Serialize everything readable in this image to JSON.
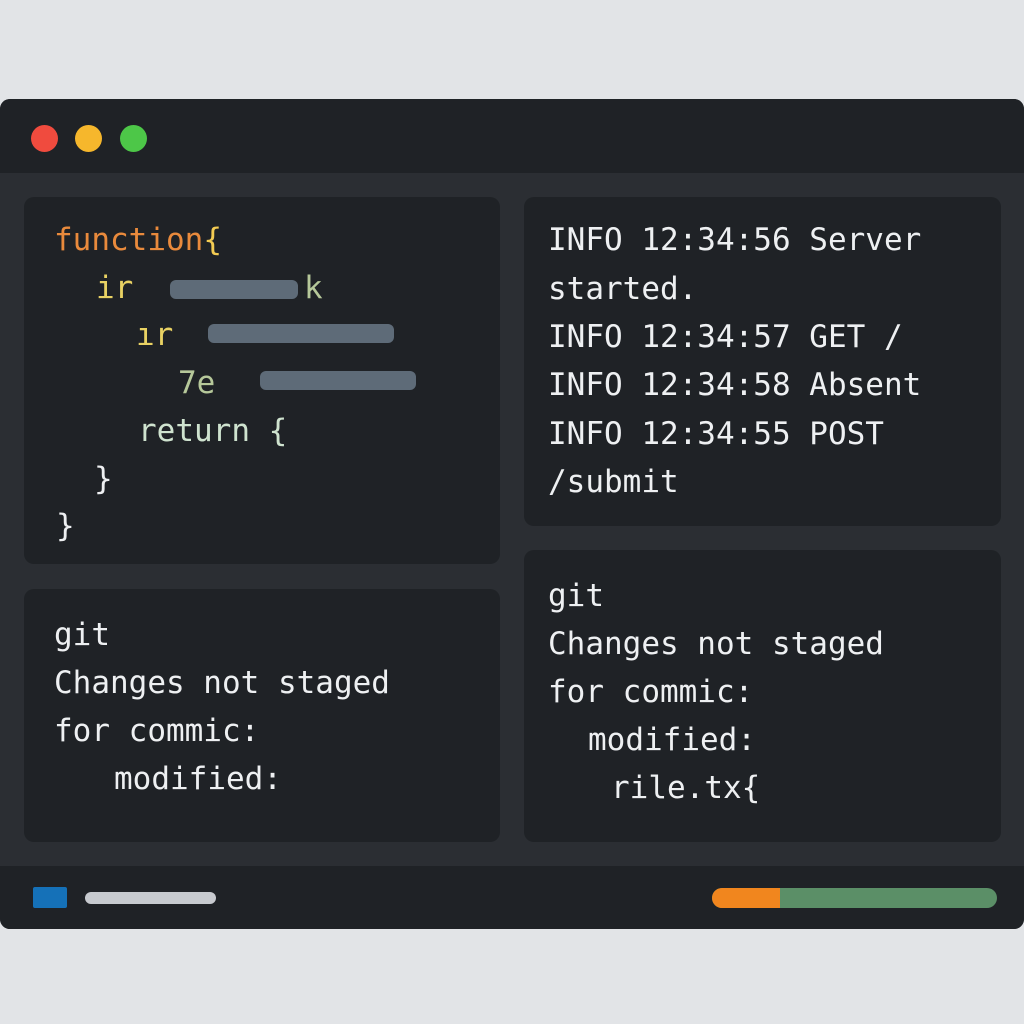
{
  "window": {
    "controls": [
      "close",
      "minimize",
      "maximize"
    ]
  },
  "code_panel": {
    "line1_keyword": "function",
    "line1_brace": "{",
    "line2_keyword": "ir",
    "line2_tail": "k",
    "line3_keyword": "ır",
    "line4_keyword": "7e",
    "line5": "return {",
    "line6": "}",
    "line7": "}"
  },
  "log_panel": {
    "lines": [
      "INFO 12:34:56 Server",
      "started.",
      "INFO 12:34:57 GET /",
      "INFO 12:34:58 Absent",
      "INFO 12:34:55 POST",
      "/submit"
    ]
  },
  "git_left": {
    "lines": [
      "git",
      "Changes not staged",
      "for commic:",
      "modified:"
    ]
  },
  "git_right": {
    "lines": [
      "git",
      "Changes not staged",
      "for commic:",
      "modified:",
      "rile.tx{"
    ]
  },
  "status_bar": {
    "progress_fraction": 0.24,
    "colors": {
      "indicator": "#1571b8",
      "progress_fill": "#f1861e",
      "progress_track": "#5b8f67"
    }
  },
  "colors": {
    "background": "#e2e4e7",
    "window": "#2b2e33",
    "panel": "#1f2226",
    "close": "#f04b3e",
    "minimize": "#f6b72c",
    "maximize": "#4dc748",
    "keyword_function": "#e98a3c",
    "keyword_if": "#e9d263"
  }
}
